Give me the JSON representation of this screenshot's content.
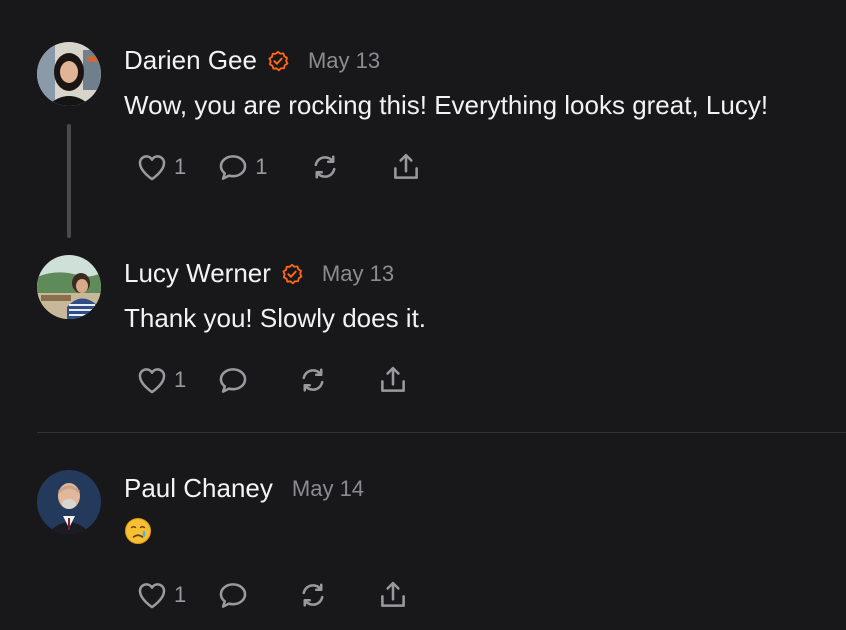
{
  "comments": [
    {
      "author": "Darien Gee",
      "verified": true,
      "date": "May 13",
      "text": "Wow, you are rocking this! Everything looks great, Lucy!",
      "likes": "1",
      "replies": "1"
    },
    {
      "author": "Lucy Werner",
      "verified": true,
      "date": "May 13",
      "text": "Thank you! Slowly does it.",
      "likes": "1",
      "replies": ""
    },
    {
      "author": "Paul Chaney",
      "verified": false,
      "date": "May 14",
      "emoji": "crying-face",
      "likes": "1",
      "replies": ""
    }
  ],
  "colors": {
    "background": "#18181a",
    "accent": "#ff6719",
    "muted": "#8c8c90"
  },
  "icons": [
    "heart-icon",
    "comment-icon",
    "restack-icon",
    "share-icon",
    "verified-badge-icon"
  ]
}
